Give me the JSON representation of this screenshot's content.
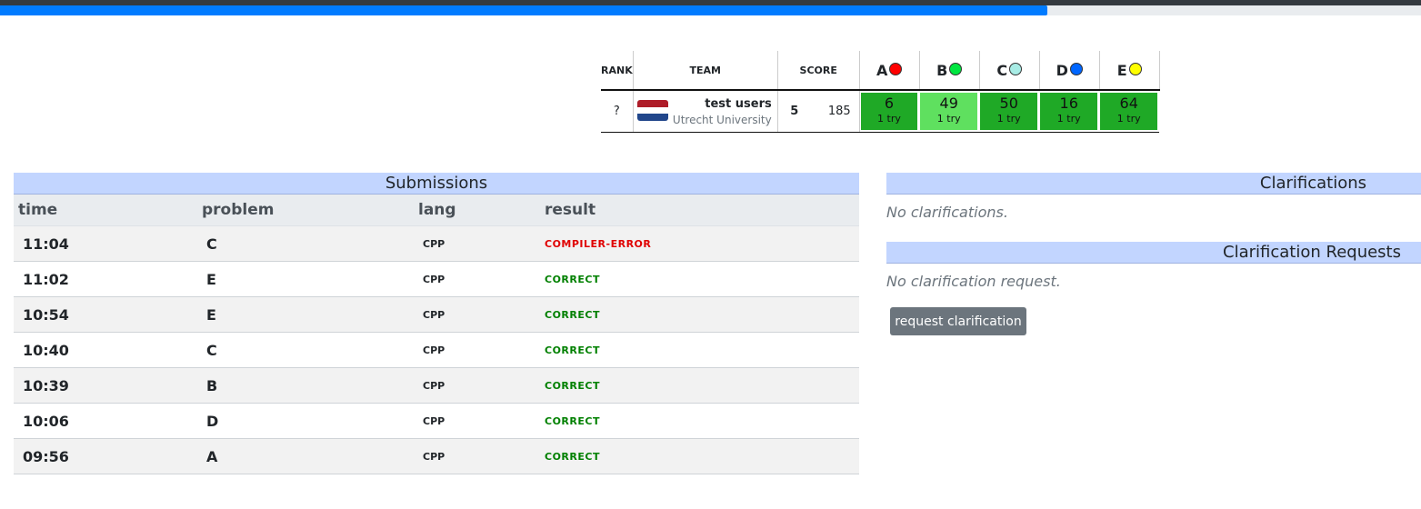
{
  "progress": {
    "fraction": 0.737,
    "color": "#007bff"
  },
  "scoreboard": {
    "headers": {
      "rank": "RANK",
      "team": "TEAM",
      "score": "SCORE"
    },
    "problems": [
      {
        "letter": "A",
        "color": "#ff0000"
      },
      {
        "letter": "B",
        "color": "#00e640"
      },
      {
        "letter": "C",
        "color": "#a8ece5"
      },
      {
        "letter": "D",
        "color": "#0066ff"
      },
      {
        "letter": "E",
        "color": "#ffff00"
      }
    ],
    "row": {
      "rank": "?",
      "flag_icon": "netherlands-flag-icon",
      "team_name": "test users",
      "affiliation": "Utrecht University",
      "solved": "5",
      "penalty": "185",
      "cells": [
        {
          "time": "6",
          "tries": "1 try",
          "bg": "#1fa926"
        },
        {
          "time": "49",
          "tries": "1 try",
          "bg": "#5fe05f"
        },
        {
          "time": "50",
          "tries": "1 try",
          "bg": "#1fa926"
        },
        {
          "time": "16",
          "tries": "1 try",
          "bg": "#1fa926"
        },
        {
          "time": "64",
          "tries": "1 try",
          "bg": "#1fa926"
        }
      ]
    }
  },
  "submissions": {
    "title": "Submissions",
    "columns": {
      "time": "time",
      "problem": "problem",
      "lang": "lang",
      "result": "result"
    },
    "rows": [
      {
        "time": "11:04",
        "problem": "C",
        "lang": "CPP",
        "result": "COMPILER-ERROR",
        "status": "error"
      },
      {
        "time": "11:02",
        "problem": "E",
        "lang": "CPP",
        "result": "CORRECT",
        "status": "ok"
      },
      {
        "time": "10:54",
        "problem": "E",
        "lang": "CPP",
        "result": "CORRECT",
        "status": "ok"
      },
      {
        "time": "10:40",
        "problem": "C",
        "lang": "CPP",
        "result": "CORRECT",
        "status": "ok"
      },
      {
        "time": "10:39",
        "problem": "B",
        "lang": "CPP",
        "result": "CORRECT",
        "status": "ok"
      },
      {
        "time": "10:06",
        "problem": "D",
        "lang": "CPP",
        "result": "CORRECT",
        "status": "ok"
      },
      {
        "time": "09:56",
        "problem": "A",
        "lang": "CPP",
        "result": "CORRECT",
        "status": "ok"
      }
    ]
  },
  "clarifications": {
    "title": "Clarifications",
    "empty": "No clarifications."
  },
  "clarification_requests": {
    "title": "Clarification Requests",
    "empty": "No clarification request.",
    "button": "request clarification"
  }
}
